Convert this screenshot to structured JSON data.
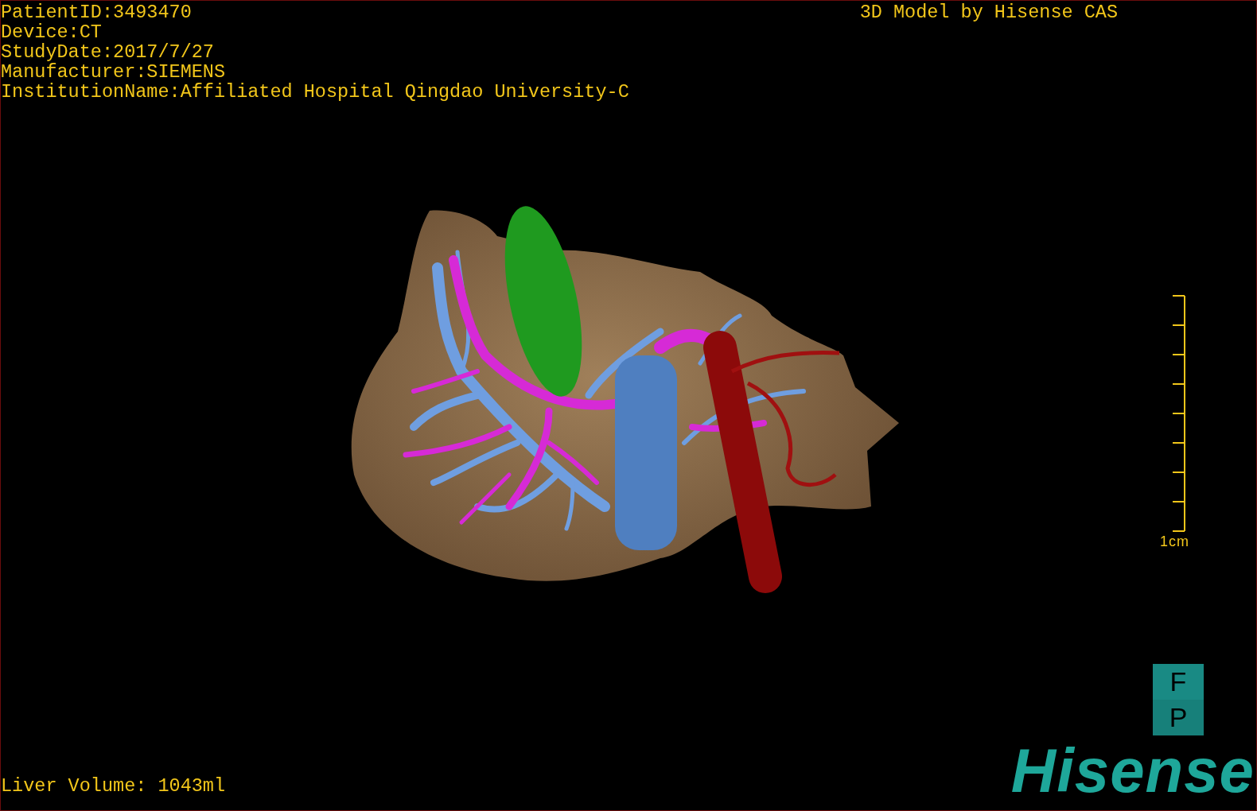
{
  "overlay": {
    "patient_info": [
      "PatientID:3493470",
      "Device:CT",
      "StudyDate:2017/7/27",
      "Manufacturer:SIEMENS",
      "InstitutionName:Affiliated Hospital Qingdao University-C"
    ],
    "title": "3D Model by Hisense CAS"
  },
  "scale": {
    "label": "1cm"
  },
  "footer": {
    "volume": "Liver Volume: 1043ml"
  },
  "logo": {
    "badge": [
      "F",
      "P"
    ],
    "brand": "Hisense"
  }
}
